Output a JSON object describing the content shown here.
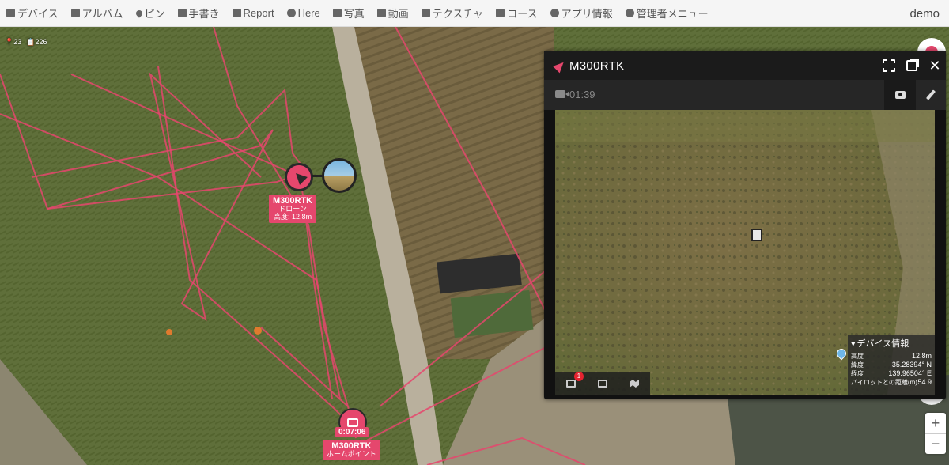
{
  "nav": {
    "items": [
      {
        "label": "デバイス",
        "icon": "device-icon"
      },
      {
        "label": "アルバム",
        "icon": "album-icon"
      },
      {
        "label": "ピン",
        "icon": "pin-icon"
      },
      {
        "label": "手書き",
        "icon": "pencil-icon"
      },
      {
        "label": "Report",
        "icon": "report-icon"
      },
      {
        "label": "Here",
        "icon": "here-icon"
      },
      {
        "label": "写真",
        "icon": "photo-icon"
      },
      {
        "label": "動画",
        "icon": "video-icon"
      },
      {
        "label": "テクスチャ",
        "icon": "texture-icon"
      },
      {
        "label": "コース",
        "icon": "course-icon"
      },
      {
        "label": "アプリ情報",
        "icon": "gear-icon"
      },
      {
        "label": "管理者メニュー",
        "icon": "admin-user-icon"
      }
    ],
    "user": "demo"
  },
  "map": {
    "counters": {
      "pins": "23",
      "reports": "226"
    },
    "drone_label": {
      "name": "M300RTK",
      "type": "ドローン",
      "altitude": "高度: 12.8m"
    },
    "home_label": {
      "time": "0:07:06",
      "name": "M300RTK",
      "type": "ホームポイント"
    },
    "zoom": {
      "in": "+",
      "out": "−"
    },
    "colors": {
      "track": "#e5476d",
      "accent": "#e5476d"
    }
  },
  "video_panel": {
    "title": "M300RTK",
    "recording_time": "01:39",
    "badge_count": "1",
    "device_info": {
      "title": "デバイス情報",
      "rows": [
        {
          "label": "高度",
          "value": "12.8m"
        },
        {
          "label": "緯度",
          "value": "35.28394° N"
        },
        {
          "label": "経度",
          "value": "139.96504° E"
        },
        {
          "label": "パイロットとの距離(m)",
          "value": "54.9"
        }
      ]
    }
  }
}
